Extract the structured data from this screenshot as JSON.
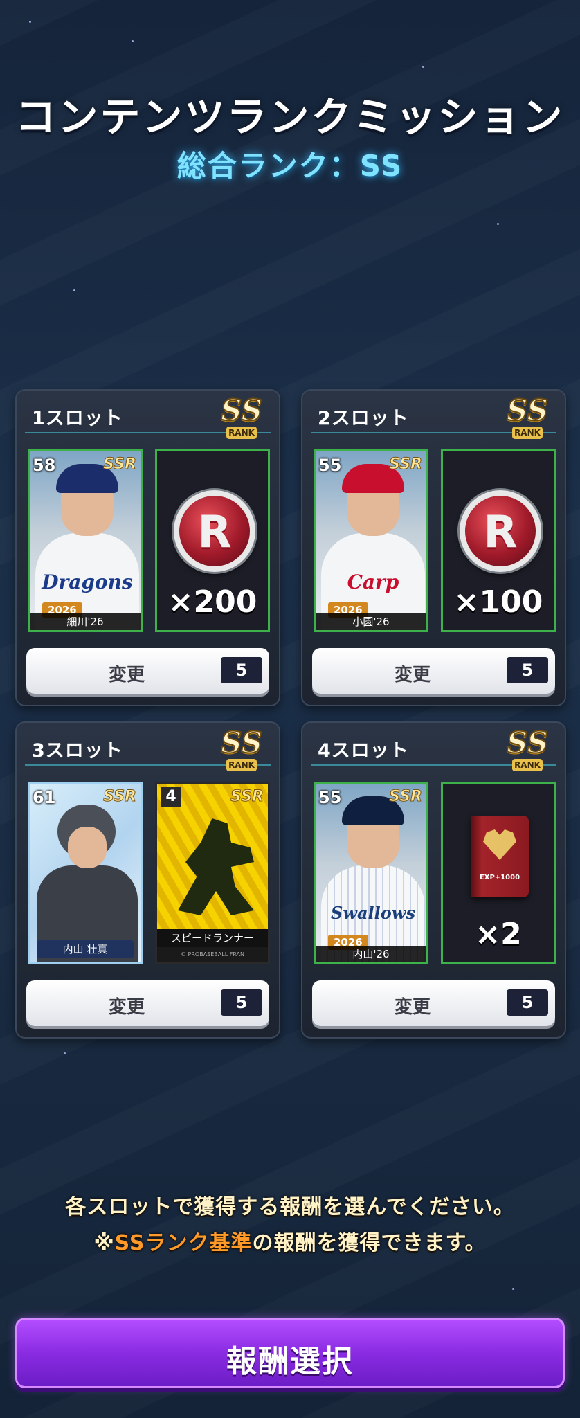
{
  "header": {
    "title": "コンテンツランクミッション",
    "overall_rank": "総合ランク：SS"
  },
  "slots": [
    {
      "label": "1スロット",
      "rank": "SS",
      "rank_word": "RANK",
      "player": {
        "number": "58",
        "rarity": "SSR",
        "team_script": "Dragons",
        "team_color": "#1a3a8a",
        "cap_color": "#1c2d6b",
        "year": "2026",
        "name": "細川'26"
      },
      "reward": {
        "type": "r-token",
        "letter": "R",
        "quantity": "×200"
      },
      "change_label": "変更",
      "cost": "5"
    },
    {
      "label": "2スロット",
      "rank": "SS",
      "rank_word": "RANK",
      "player": {
        "number": "55",
        "rarity": "SSR",
        "team_script": "Carp",
        "team_color": "#c8102e",
        "cap_color": "#c8102e",
        "year": "2026",
        "name": "小園'26"
      },
      "reward": {
        "type": "r-token",
        "letter": "R",
        "quantity": "×100"
      },
      "change_label": "変更",
      "cost": "5"
    },
    {
      "label": "3スロット",
      "rank": "SS",
      "rank_word": "RANK",
      "player": {
        "number": "61",
        "rarity": "SSR",
        "name": "内山 壮真"
      },
      "reward": {
        "type": "skill-card",
        "number": "4",
        "rarity": "SSR",
        "name": "スピードランナー",
        "copyright": "© PROBASEBALL FRAN"
      },
      "change_label": "変更",
      "cost": "5"
    },
    {
      "label": "4スロット",
      "rank": "SS",
      "rank_word": "RANK",
      "player": {
        "number": "55",
        "rarity": "SSR",
        "team_script": "Swallows",
        "team_color": "#1a3f7a",
        "cap_color": "#0f1f3f",
        "year": "2026",
        "name": "内山'26"
      },
      "reward": {
        "type": "exp-book",
        "label": "EXP+1000",
        "quantity": "×2"
      },
      "change_label": "変更",
      "cost": "5"
    }
  ],
  "info": {
    "line1": "各スロットで獲得する報酬を選んでください。",
    "line2_prefix": "※",
    "line2_highlight": "SSランク基準",
    "line2_suffix": "の報酬を獲得できます。"
  },
  "footer": {
    "reward_select_label": "報酬選択"
  },
  "colors": {
    "accent_purple": "#8a2ce2",
    "card_border_green": "#3eb24a",
    "rank_gold": "#e9c04a",
    "highlight_orange": "#ff9a2a",
    "overall_rank_cyan": "#7fe3ff"
  }
}
